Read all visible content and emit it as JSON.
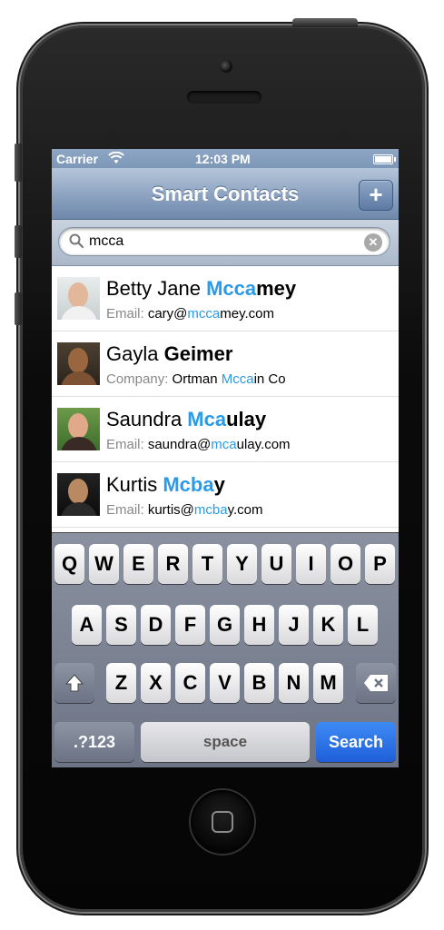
{
  "status": {
    "carrier": "Carrier",
    "time": "12:03 PM"
  },
  "nav": {
    "title": "Smart Contacts",
    "add_label": "+"
  },
  "search": {
    "value": "mcca"
  },
  "contacts": [
    {
      "name_pre": "Betty Jane ",
      "name_hl": "Mcca",
      "name_post": "mey",
      "detail_label": "Email: ",
      "detail_pre": "cary@",
      "detail_hl": "mcca",
      "detail_post": "mey.com"
    },
    {
      "name_pre": "Gayla ",
      "name_hl": "",
      "name_post": "Geimer",
      "detail_label": "Company: ",
      "detail_pre": "Ortman ",
      "detail_hl": "Mcca",
      "detail_post": "in Co"
    },
    {
      "name_pre": "Saundra ",
      "name_hl": "Mca",
      "name_post": "ulay",
      "detail_label": "Email: ",
      "detail_pre": "saundra@",
      "detail_hl": "mca",
      "detail_post": "ulay.com"
    },
    {
      "name_pre": "Kurtis ",
      "name_hl": "Mcba",
      "name_post": "y",
      "detail_label": "Email: ",
      "detail_pre": "kurtis@",
      "detail_hl": "mcba",
      "detail_post": "y.com"
    }
  ],
  "keyboard": {
    "row1": [
      "Q",
      "W",
      "E",
      "R",
      "T",
      "Y",
      "U",
      "I",
      "O",
      "P"
    ],
    "row2": [
      "A",
      "S",
      "D",
      "F",
      "G",
      "H",
      "J",
      "K",
      "L"
    ],
    "row3": [
      "Z",
      "X",
      "C",
      "V",
      "B",
      "N",
      "M"
    ],
    "shift_icon": "shift-arrow-icon",
    "delete_icon": "backspace-icon",
    "numbers_label": ".?123",
    "space_label": "space",
    "search_label": "Search"
  },
  "colors": {
    "highlight": "#2a9be8",
    "search_key": "#1f5fd9",
    "nav_bar": "#8fa5c2"
  }
}
